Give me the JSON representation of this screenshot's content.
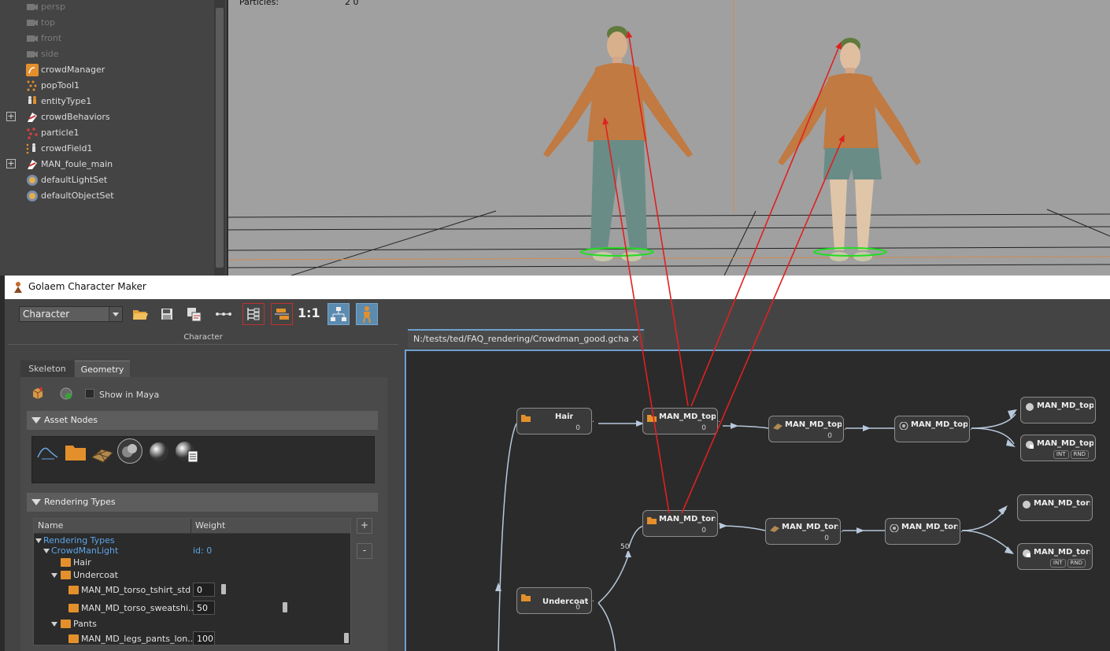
{
  "outliner": {
    "items": [
      {
        "label": "persp",
        "icon": "camera-icon",
        "dim": true,
        "expandable": false
      },
      {
        "label": "top",
        "icon": "camera-icon",
        "dim": true,
        "expandable": false
      },
      {
        "label": "front",
        "icon": "camera-icon",
        "dim": true,
        "expandable": false
      },
      {
        "label": "side",
        "icon": "camera-icon",
        "dim": true,
        "expandable": false
      },
      {
        "label": "crowdManager",
        "icon": "crowd-manager-icon",
        "dim": false,
        "expandable": false
      },
      {
        "label": "popTool1",
        "icon": "population-tool-icon",
        "dim": false,
        "expandable": false
      },
      {
        "label": "entityType1",
        "icon": "entity-type-icon",
        "dim": false,
        "expandable": false
      },
      {
        "label": "crowdBehaviors",
        "icon": "behavior-graph-icon",
        "dim": false,
        "expandable": true
      },
      {
        "label": "particle1",
        "icon": "particle-icon",
        "dim": false,
        "expandable": false
      },
      {
        "label": "crowdField1",
        "icon": "crowd-field-icon",
        "dim": false,
        "expandable": false
      },
      {
        "label": "MAN_foule_main",
        "icon": "behavior-graph-icon",
        "dim": false,
        "expandable": true
      },
      {
        "label": "defaultLightSet",
        "icon": "set-icon",
        "dim": false,
        "expandable": false
      },
      {
        "label": "defaultObjectSet",
        "icon": "set-icon",
        "dim": false,
        "expandable": false
      }
    ],
    "expander_glyph": "+"
  },
  "viewport": {
    "readout_label": "Particles:",
    "readout_value": "2    0"
  },
  "gcm": {
    "window_title": "Golaem Character Maker",
    "combo_value": "Character",
    "one_to_one_label": "1:1",
    "panel_title": "Character",
    "tabs": {
      "skeleton": "Skeleton",
      "geometry": "Geometry"
    },
    "show_in_maya": "Show in Maya",
    "asset_nodes_title": "Asset Nodes",
    "rendering_types_title": "Rendering Types",
    "table": {
      "col_name": "Name",
      "col_weight": "Weight",
      "root": "Rendering Types",
      "type_name": "CrowdManLight",
      "type_id": "id: 0",
      "rows": {
        "hair": "Hair",
        "undercoat": "Undercoat",
        "tshirt": "MAN_MD_torso_tshirt_std",
        "tshirt_weight": "0",
        "sweatshirt": "MAN_MD_torso_sweatshi...",
        "sweatshirt_weight": "50",
        "pants": "Pants",
        "legs": "MAN_MD_legs_pants_lon...",
        "legs_weight": "100"
      },
      "add_label": "+",
      "remove_label": "-"
    },
    "weights": {
      "tshirt": 0,
      "sweatshirt": 50,
      "legs": 100
    },
    "graph_tab": {
      "path": "N:/tests/ted/FAQ_rendering/Crowdman_good.gcha",
      "close": "×"
    },
    "nodes": {
      "hair": {
        "title": "Hair",
        "badge": "0"
      },
      "top_group": {
        "title": "MAN_MD_top_...",
        "badge": "0"
      },
      "top_mesh": {
        "title": "MAN_MD_top_...",
        "badge": "0"
      },
      "top_fbx": {
        "title": "MAN_MD_top_..."
      },
      "top_mat1": {
        "title": "MAN_MD_top_..."
      },
      "top_mat2": {
        "title": "MAN_MD_top_...",
        "chip1": "INT",
        "chip2": "RND"
      },
      "undercoat": {
        "title": "Undercoat",
        "badge": "0"
      },
      "torso_group": {
        "title": "MAN_MD_tors...",
        "badge": "0"
      },
      "torso_mesh": {
        "title": "MAN_MD_tors...",
        "badge": "0"
      },
      "torso_fbx": {
        "title": "MAN_MD_tors..."
      },
      "torso_mat1": {
        "title": "MAN_MD_tors..."
      },
      "torso_mat2": {
        "title": "MAN_MD_tors...",
        "chip1": "INT",
        "chip2": "RND"
      }
    },
    "edge_weight_label": "50"
  },
  "colors": {
    "annotation_arrow": "#e02020",
    "folder": "#e3902c",
    "accent": "#6ea0d0",
    "viewport_bg": "#a0a0a0"
  }
}
